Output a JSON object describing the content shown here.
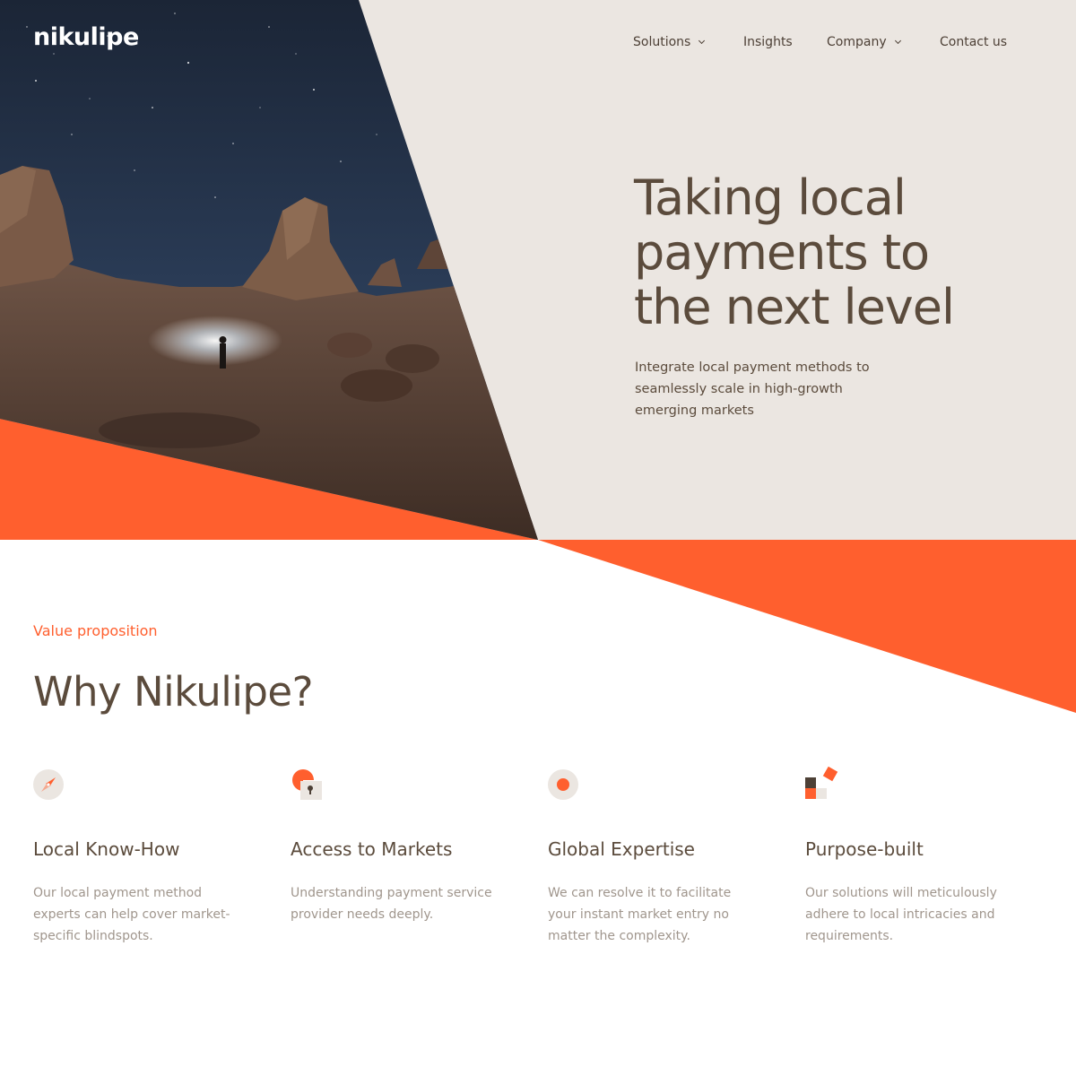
{
  "brand": {
    "name": "nikulipe",
    "accent": "#ff5f2e",
    "sand": "#ebe6e1",
    "ink": "#5b4b3c"
  },
  "nav": {
    "items": [
      {
        "label": "Solutions",
        "dropdown": true
      },
      {
        "label": "Insights",
        "dropdown": false
      },
      {
        "label": "Company",
        "dropdown": true
      },
      {
        "label": "Contact us",
        "dropdown": false
      }
    ]
  },
  "hero": {
    "title": "Taking local payments to the next level",
    "subtitle": "Integrate local payment methods to seamlessly scale in high-growth emerging markets"
  },
  "section": {
    "eyebrow": "Value proposition",
    "title": "Why Nikulipe?"
  },
  "features": [
    {
      "icon": "compass-icon",
      "title": "Local Know-How",
      "text": "Our local payment method experts can help cover market-specific blindspots."
    },
    {
      "icon": "keyhole-icon",
      "title": "Access to Markets",
      "text": "Understanding payment service provider needs deeply."
    },
    {
      "icon": "target-dot-icon",
      "title": "Global Expertise",
      "text": "We can resolve it to facilitate your instant market entry no matter the complexity."
    },
    {
      "icon": "blocks-icon",
      "title": "Purpose-built",
      "text": "Our solutions will meticulously adhere to local intricacies and requirements."
    }
  ]
}
